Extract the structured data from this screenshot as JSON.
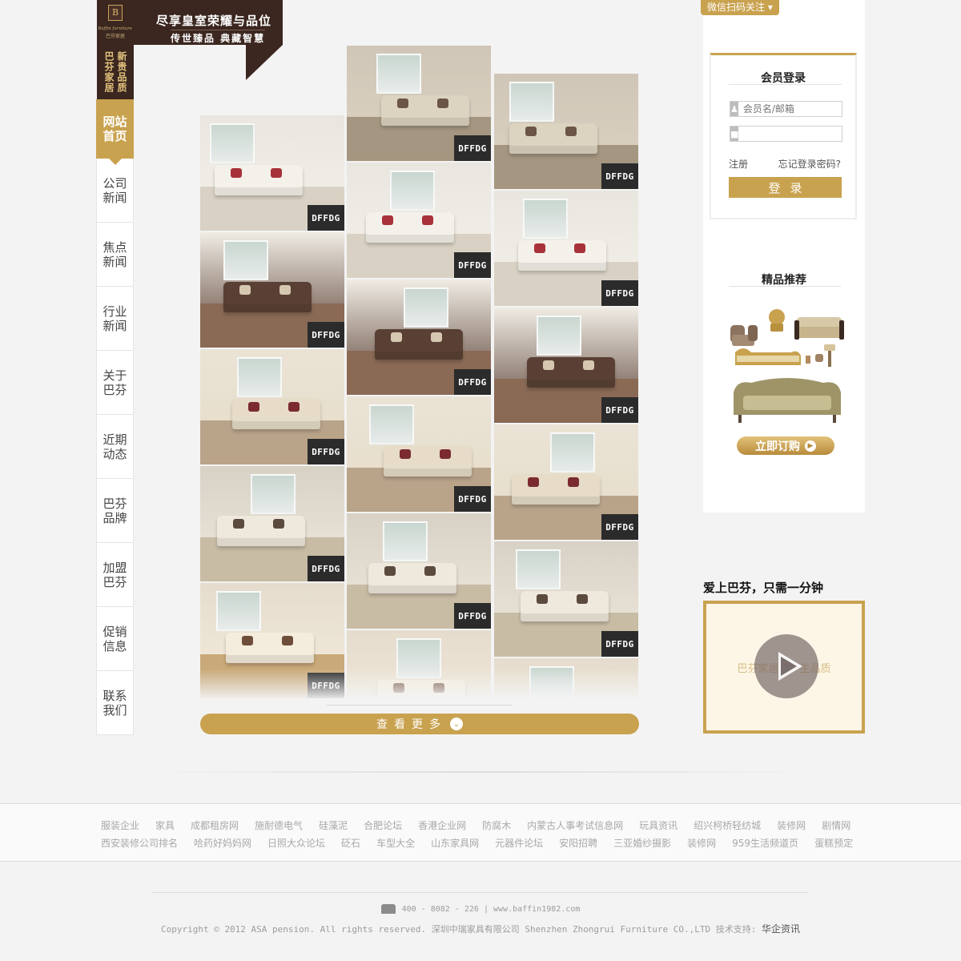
{
  "header": {
    "slogan_line1": "尽享皇室荣耀与品位",
    "slogan_line2": "传世臻品  典藏智慧",
    "vertical_left": "巴芬家居",
    "vertical_right": "新贵品质",
    "crest_letter": "B",
    "brand_script": "Baffin furniture",
    "brand_cn": "巴芬家居"
  },
  "nav": {
    "items": [
      {
        "label": "网站首页",
        "active": true
      },
      {
        "label": "公司新闻",
        "active": false
      },
      {
        "label": "焦点新闻",
        "active": false
      },
      {
        "label": "行业新闻",
        "active": false
      },
      {
        "label": "关于巴芬",
        "active": false
      },
      {
        "label": "近期动态",
        "active": false
      },
      {
        "label": "巴芬品牌",
        "active": false
      },
      {
        "label": "加盟巴芬",
        "active": false
      },
      {
        "label": "促销信息",
        "active": false
      },
      {
        "label": "联系我们",
        "active": false
      }
    ]
  },
  "gallery": {
    "badge_text": "DFFDG",
    "more_label": "查看更多",
    "more_icon": "chevron-down-icon"
  },
  "wechat": {
    "label": "微信扫码关注 ▾"
  },
  "login": {
    "title": "会员登录",
    "username_placeholder": "会员名/邮箱",
    "password_placeholder": "",
    "register_label": "注册",
    "forgot_label": "忘记登录密码?",
    "submit_label": "登录"
  },
  "recommend": {
    "title": "精品推荐",
    "buy_label": "立即订购"
  },
  "video": {
    "title": "爱上巴芬，只需一分钟",
    "caption": "巴芬家居，一生品质"
  },
  "friend_links": {
    "row1": [
      "服装企业",
      "家具",
      "成都租房网",
      "施耐德电气",
      "硅藻泥",
      "合肥论坛",
      "香港企业网",
      "防腐木",
      "内蒙古人事考试信息网",
      "玩具资讯",
      "绍兴柯桥轻纺城",
      "装修网",
      "剧情网"
    ],
    "row2": [
      "西安装修公司排名",
      "哈药好妈妈网",
      "日照大众论坛",
      "砭石",
      "车型大全",
      "山东家具网",
      "元器件论坛",
      "安阳招聘",
      "三亚婚纱摄影",
      "装修网",
      "959生活频道页",
      "蛋糕预定"
    ]
  },
  "footer": {
    "contact": "400 - 8082 - 226   |   www.baffin1982.com",
    "copyright": "Copyright © 2012 ASA pension. All rights reserved. 深圳中瑞家具有限公司 Shenzhen Zhongrui Furniture CO.,LTD 技术支持: ",
    "support": "华企资讯"
  },
  "colors": {
    "gold": "#c9a24f",
    "dark_brown": "#3b2720",
    "badge": "#2b2b2b"
  }
}
